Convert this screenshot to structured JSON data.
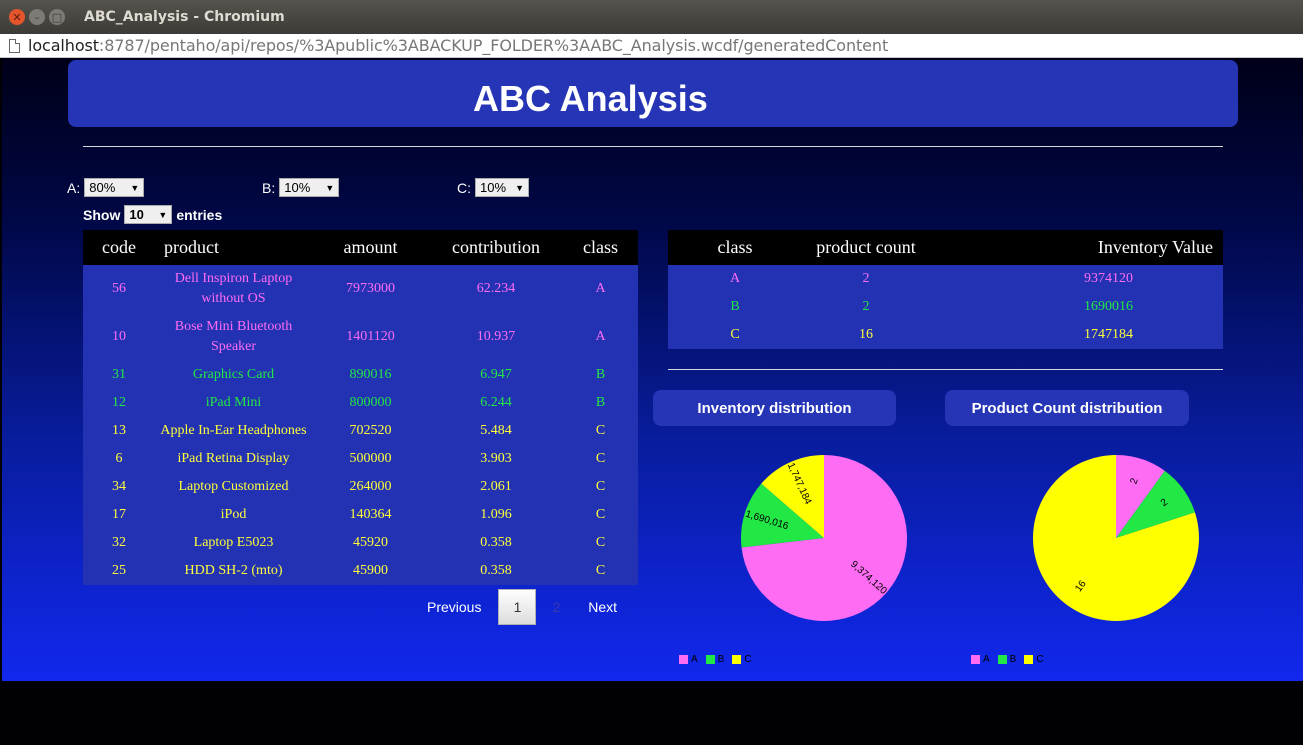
{
  "window": {
    "title": "ABC_Analysis - Chromium"
  },
  "address": {
    "host": "localhost",
    "rest": ":8787/pentaho/api/repos/%3Apublic%3ABACKUP_FOLDER%3AABC_Analysis.wcdf/generatedContent"
  },
  "page_title": "ABC Analysis",
  "filters": {
    "a": {
      "label": "A:",
      "value": "80%"
    },
    "b": {
      "label": "B:",
      "value": "10%"
    },
    "c": {
      "label": "C:",
      "value": "10%"
    }
  },
  "show_entries": {
    "show": "Show",
    "value": "10",
    "entries": "entries"
  },
  "colors": {
    "A": "#ff6cf4",
    "B": "#22e845",
    "C": "#ffff3a"
  },
  "main_table": {
    "headers": [
      "code",
      "product",
      "amount",
      "contribution",
      "class"
    ],
    "rows": [
      [
        "56",
        "Dell Inspiron Laptop without OS",
        "7973000",
        "62.234",
        "A"
      ],
      [
        "10",
        "Bose Mini Bluetooth Speaker",
        "1401120",
        "10.937",
        "A"
      ],
      [
        "31",
        "Graphics Card",
        "890016",
        "6.947",
        "B"
      ],
      [
        "12",
        "iPad Mini",
        "800000",
        "6.244",
        "B"
      ],
      [
        "13",
        "Apple In-Ear Headphones",
        "702520",
        "5.484",
        "C"
      ],
      [
        "6",
        "iPad Retina Display",
        "500000",
        "3.903",
        "C"
      ],
      [
        "34",
        "Laptop Customized",
        "264000",
        "2.061",
        "C"
      ],
      [
        "17",
        "iPod",
        "140364",
        "1.096",
        "C"
      ],
      [
        "32",
        "Laptop E5023",
        "45920",
        "0.358",
        "C"
      ],
      [
        "25",
        "HDD SH-2 (mto)",
        "45900",
        "0.358",
        "C"
      ]
    ]
  },
  "pager": {
    "previous": "Previous",
    "page1": "1",
    "page2": "2",
    "next": "Next"
  },
  "summary_table": {
    "headers": [
      "class",
      "product count",
      "Inventory Value"
    ],
    "rows": [
      [
        "A",
        "2",
        "9374120"
      ],
      [
        "B",
        "2",
        "1690016"
      ],
      [
        "C",
        "16",
        "1747184"
      ]
    ]
  },
  "chart_data": [
    {
      "type": "pie",
      "title": "Inventory distribution",
      "categories": [
        "A",
        "B",
        "C"
      ],
      "values": [
        9374120,
        1690016,
        1747184
      ],
      "labels": [
        "9,374,120",
        "1,690,016",
        "1,747,184"
      ],
      "colors": [
        "#ff6cf4",
        "#22e845",
        "#ffff00"
      ],
      "legend": "bottom-left"
    },
    {
      "type": "pie",
      "title": "Product Count distribution",
      "categories": [
        "A",
        "B",
        "C"
      ],
      "values": [
        2,
        2,
        16
      ],
      "labels": [
        "2",
        "2",
        "16"
      ],
      "colors": [
        "#ff6cf4",
        "#22e845",
        "#ffff00"
      ],
      "legend": "bottom-left"
    }
  ]
}
